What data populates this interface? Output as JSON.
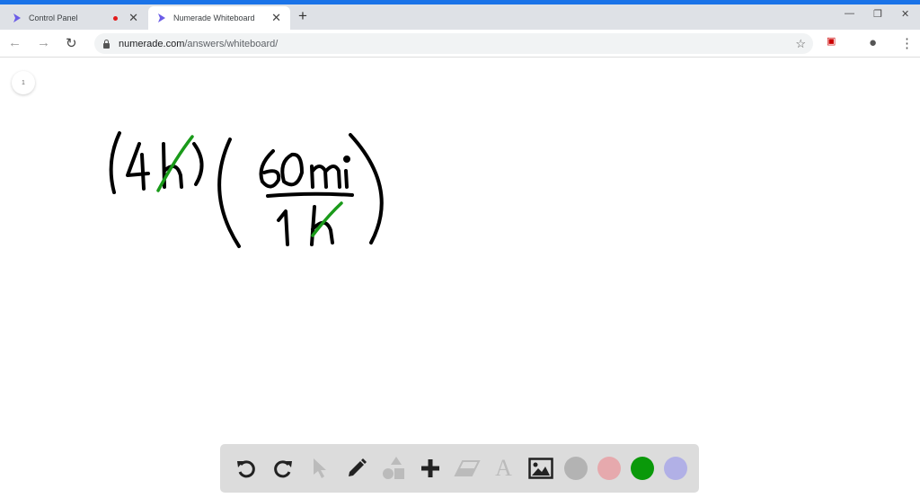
{
  "browser": {
    "tabs": [
      {
        "title": "Control Panel",
        "recording": true
      },
      {
        "title": "Numerade Whiteboard",
        "active": true
      }
    ],
    "url_host": "numerade.com",
    "url_path": "/answers/whiteboard/"
  },
  "page": {
    "page_number": "1"
  },
  "whiteboard": {
    "content": "(4h)(60 mi / 1h)",
    "ink_colors": {
      "black": "#000000",
      "green": "#1a9a1a"
    }
  },
  "toolbar": {
    "tools": [
      "undo-icon",
      "redo-icon",
      "select-icon",
      "pencil-icon",
      "shapes-icon",
      "add-icon",
      "eraser-icon",
      "text-icon",
      "image-icon"
    ],
    "colors": [
      "#b3b3b3",
      "#e6a9ad",
      "#0a990a",
      "#b1b0e6"
    ]
  }
}
